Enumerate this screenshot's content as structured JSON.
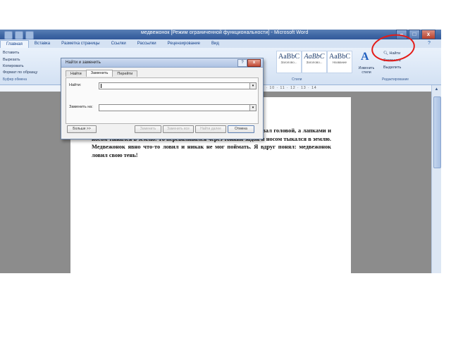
{
  "window": {
    "title": "медвежонок [Режим ограниченной функциональности] - Microsoft Word",
    "buttons": {
      "minimize": "–",
      "maximize": "□",
      "close": "x"
    }
  },
  "ribbon_tabs": [
    "Главная",
    "Вставка",
    "Разметка страницы",
    "Ссылки",
    "Рассылки",
    "Рецензирование",
    "Вид"
  ],
  "ribbon": {
    "clipboard": {
      "paste": "Вставить",
      "cut": "Вырезать",
      "copy": "Копировать",
      "format_painter": "Формат по образцу",
      "label": "Буфер обмена"
    },
    "styles": [
      {
        "sample": "AaBbC",
        "name": "Заголово..."
      },
      {
        "sample": "AaBbC",
        "name": "Заголово..."
      },
      {
        "sample": "AaBbC",
        "name": "Название"
      }
    ],
    "styles_label": "Стили",
    "change_styles": "Изменить стили",
    "editing": {
      "find": "Найти",
      "replace": "Заменить",
      "select": "Выделить",
      "label": "Редактирование"
    }
  },
  "ruler": {
    "numbers": "8 · 9 · 10 · 11 · 12 · 13 · 14"
  },
  "document": {
    "text": "…медвежонок. Он был один и …был странно. То вдруг взмахивал головой, а лапками и носом тыкался в землю. То переваливался через тонкий задок и носом тыкался в землю. Медвежонок явно что-то ловил и никак не мог поймать. Я вдруг понял: медвежонок ловил свою тень!"
  },
  "dialog": {
    "title": "Найти и заменить",
    "help": "?",
    "close": "x",
    "tabs": [
      "Найти",
      "Заменить",
      "Перейти"
    ],
    "active_tab": 1,
    "find_label": "Найти:",
    "replace_label": "Заменить на:",
    "find_value": "",
    "replace_value": "",
    "buttons": {
      "more": "Больше >>",
      "replace": "Заменить",
      "replace_all": "Заменить все",
      "find_next": "Найти далее",
      "cancel": "Отмена"
    }
  },
  "colors": {
    "annotation": "#e41b17",
    "titlebar": "#3e66a3",
    "ribbon": "#d3e1f3"
  }
}
